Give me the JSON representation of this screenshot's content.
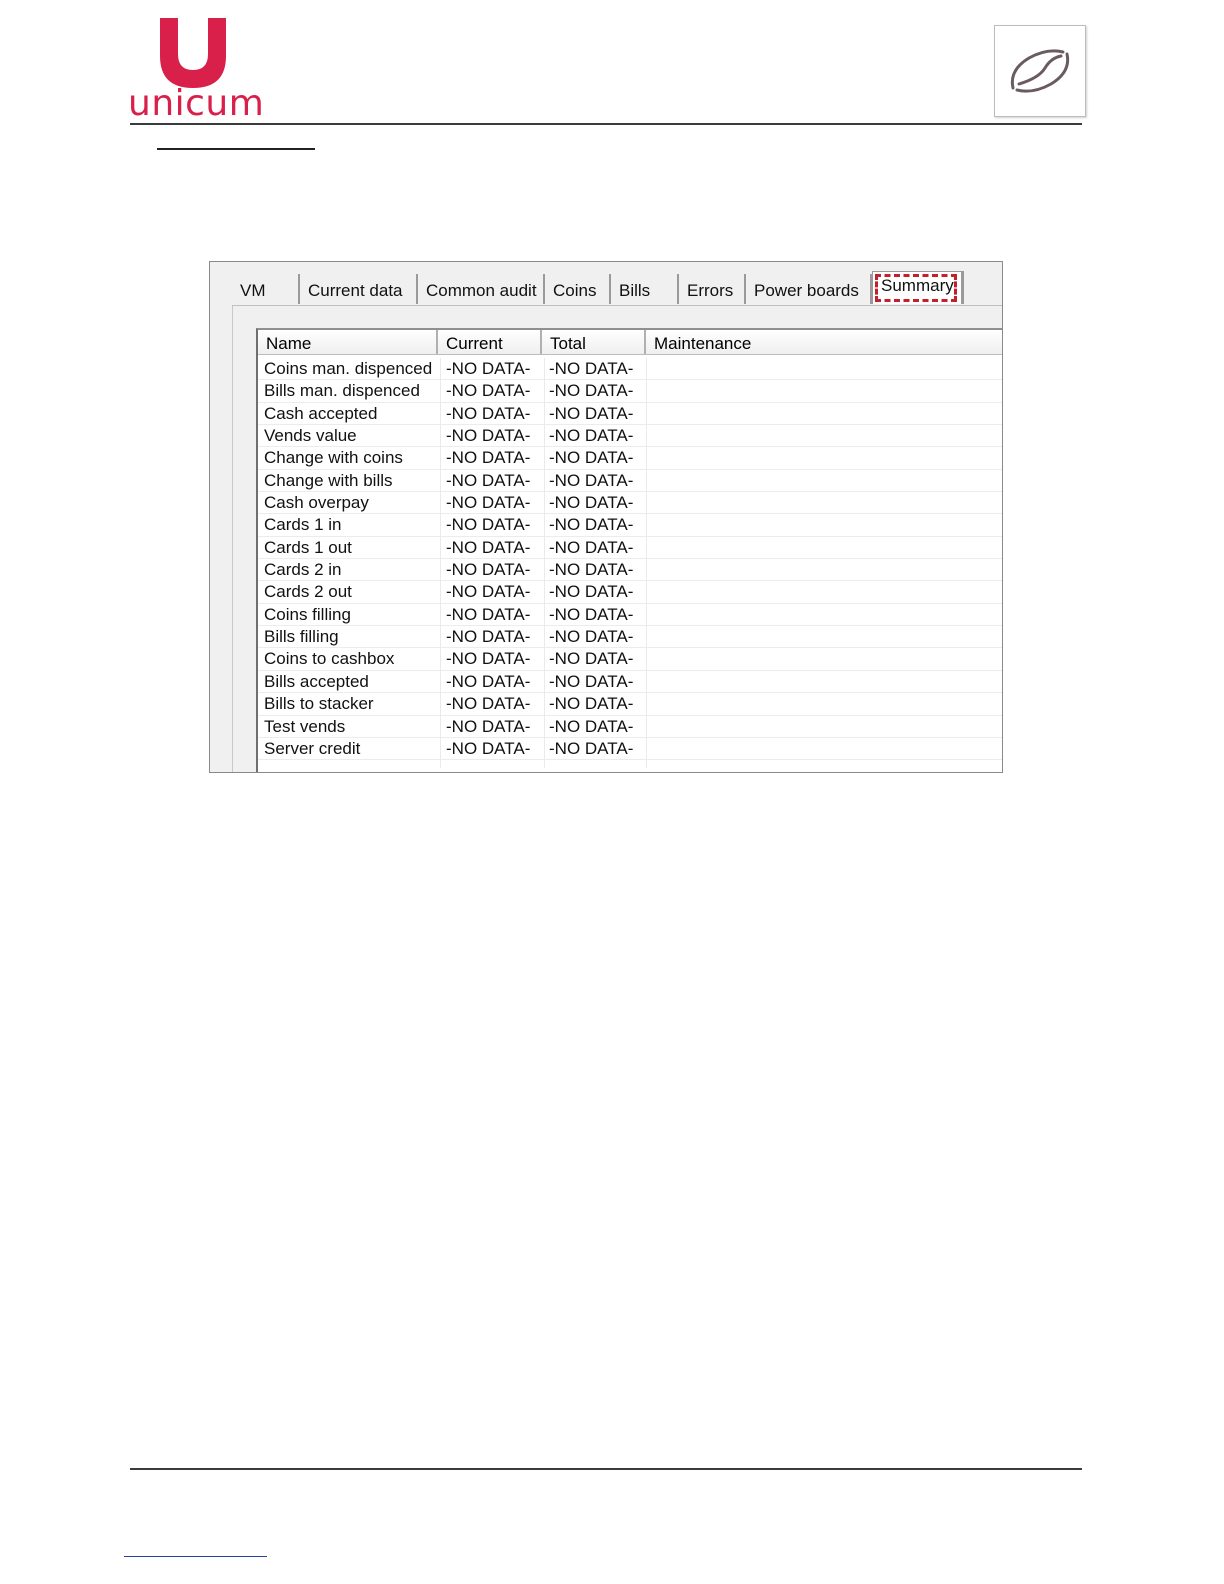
{
  "brand": {
    "logo_text": "unicum",
    "logo_color": "#d8204a"
  },
  "icons": {
    "brand_mark": "coffee-bean-icon"
  },
  "panel": {
    "tabs": [
      {
        "label": "VM"
      },
      {
        "label": "Current data"
      },
      {
        "label": "Common audit"
      },
      {
        "label": "Coins"
      },
      {
        "label": "Bills"
      },
      {
        "label": "Errors"
      },
      {
        "label": "Power boards"
      },
      {
        "label": "Summary",
        "active": true
      }
    ],
    "highlight_color": "#c41f2c",
    "table": {
      "columns": [
        "Name",
        "Current",
        "Total",
        "Maintenance"
      ],
      "rows": [
        {
          "name": "Coins man. dispenced",
          "current": "-NO DATA-",
          "total": "-NO DATA-",
          "maintenance": ""
        },
        {
          "name": "Bills man. dispenced",
          "current": "-NO DATA-",
          "total": "-NO DATA-",
          "maintenance": ""
        },
        {
          "name": "Cash accepted",
          "current": "-NO DATA-",
          "total": "-NO DATA-",
          "maintenance": ""
        },
        {
          "name": "Vends value",
          "current": "-NO DATA-",
          "total": "-NO DATA-",
          "maintenance": ""
        },
        {
          "name": "Change with coins",
          "current": "-NO DATA-",
          "total": "-NO DATA-",
          "maintenance": ""
        },
        {
          "name": "Change with bills",
          "current": "-NO DATA-",
          "total": "-NO DATA-",
          "maintenance": ""
        },
        {
          "name": "Cash overpay",
          "current": "-NO DATA-",
          "total": "-NO DATA-",
          "maintenance": ""
        },
        {
          "name": "Cards 1 in",
          "current": "-NO DATA-",
          "total": "-NO DATA-",
          "maintenance": ""
        },
        {
          "name": "Cards 1 out",
          "current": "-NO DATA-",
          "total": "-NO DATA-",
          "maintenance": ""
        },
        {
          "name": "Cards 2 in",
          "current": "-NO DATA-",
          "total": "-NO DATA-",
          "maintenance": ""
        },
        {
          "name": "Cards 2 out",
          "current": "-NO DATA-",
          "total": "-NO DATA-",
          "maintenance": ""
        },
        {
          "name": "Coins filling",
          "current": "-NO DATA-",
          "total": "-NO DATA-",
          "maintenance": ""
        },
        {
          "name": "Bills filling",
          "current": "-NO DATA-",
          "total": "-NO DATA-",
          "maintenance": ""
        },
        {
          "name": "Coins to cashbox",
          "current": "-NO DATA-",
          "total": "-NO DATA-",
          "maintenance": ""
        },
        {
          "name": "Bills accepted",
          "current": "-NO DATA-",
          "total": "-NO DATA-",
          "maintenance": ""
        },
        {
          "name": "Bills to stacker",
          "current": "-NO DATA-",
          "total": "-NO DATA-",
          "maintenance": ""
        },
        {
          "name": "Test vends",
          "current": "-NO DATA-",
          "total": "-NO DATA-",
          "maintenance": ""
        },
        {
          "name": "Server credit",
          "current": "-NO DATA-",
          "total": "-NO DATA-",
          "maintenance": ""
        }
      ]
    }
  }
}
